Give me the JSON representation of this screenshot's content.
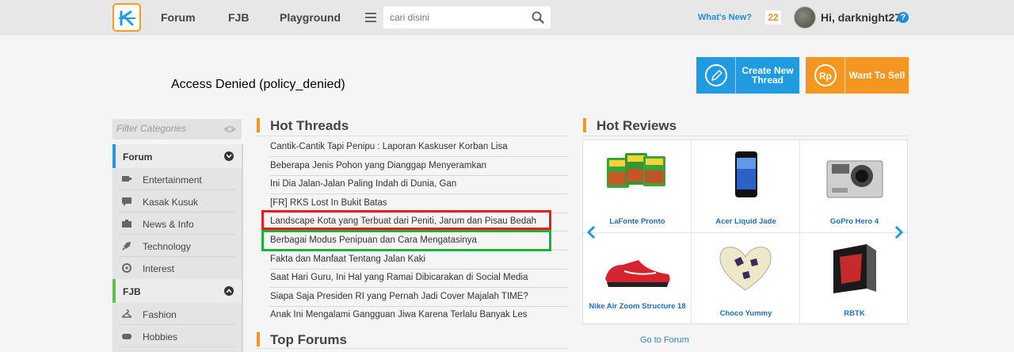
{
  "header": {
    "nav": [
      "Forum",
      "FJB",
      "Playground"
    ],
    "search_placeholder": "cari disini",
    "whats_new": "What's New?",
    "notif_count": "22",
    "greeting": "Hi, darknight27",
    "help": "?"
  },
  "message": "Access Denied (policy_denied)",
  "actions": {
    "create_thread": "Create New Thread",
    "want_to_sell": "Want To Sell"
  },
  "sidebar": {
    "filter_placeholder": "Filter Categories",
    "sections": [
      {
        "title": "Forum",
        "items": [
          "Entertainment",
          "Kasak Kusuk",
          "News & Info",
          "Technology",
          "Interest"
        ]
      },
      {
        "title": "FJB",
        "items": [
          "Fashion",
          "Hobbies"
        ]
      }
    ]
  },
  "hot_threads": {
    "title": "Hot Threads",
    "items": [
      "Cantik-Cantik Tapi Penipu : Laporan Kaskuser Korban Lisa",
      "Beberapa Jenis Pohon yang Dianggap Menyeramkan",
      "Ini Dia Jalan-Jalan Paling Indah di Dunia, Gan",
      "[FR] RKS Lost In Bukit Batas",
      "Landscape Kota yang Terbuat dari Peniti, Jarum dan Pisau Bedah",
      "Berbagai Modus Penipuan dan Cara Mengatasinya",
      "Fakta dan Manfaat Tentang Jalan Kaki",
      "Saat Hari Guru, Ini Hal yang Ramai Dibicarakan di Social Media",
      "Siapa Saja Presiden RI yang Pernah Jadi Cover Majalah TIME?",
      "Anak Ini Mengalami Gangguan Jiwa Karena Terlalu Banyak Les"
    ]
  },
  "top_forums": {
    "title": "Top Forums",
    "link": "Go to Forum"
  },
  "hot_reviews": {
    "title": "Hot Reviews",
    "items": [
      {
        "name": "LaFonte Pronto"
      },
      {
        "name": "Acer Liquid Jade"
      },
      {
        "name": "GoPro Hero 4"
      },
      {
        "name": "Nike Air Zoom Structure 18"
      },
      {
        "name": "Choco Yummy"
      },
      {
        "name": "RBTK"
      }
    ]
  },
  "colors": {
    "orange": "#f4961f",
    "blue": "#1e9be1",
    "red_highlight": "#e41f1f",
    "green_highlight": "#1fae3a"
  }
}
